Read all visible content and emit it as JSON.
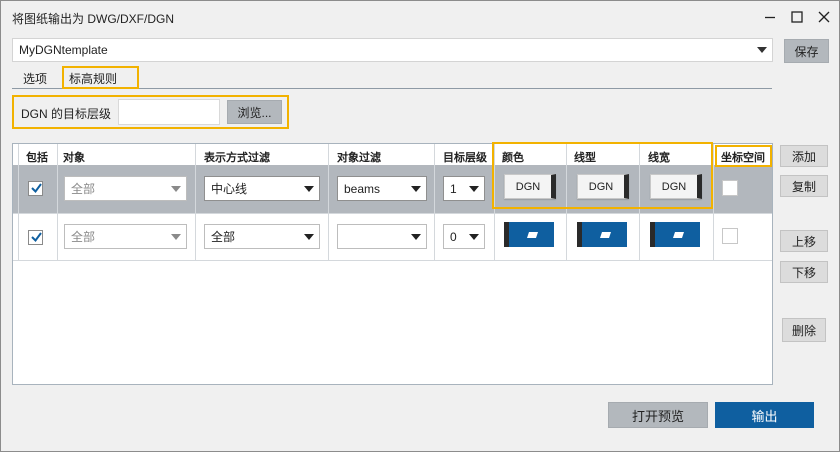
{
  "window": {
    "title": "将图纸输出为 DWG/DXF/DGN"
  },
  "template": {
    "value": "MyDGNtemplate",
    "save_label": "保存"
  },
  "tabs": [
    {
      "label": "选项"
    },
    {
      "label": "标高规则"
    }
  ],
  "layer": {
    "label": "DGN 的目标层级",
    "value": "",
    "browse_label": "浏览..."
  },
  "grid": {
    "headers": {
      "include": "包括",
      "object": "对象",
      "repr_filter": "表示方式过滤",
      "object_filter": "对象过滤",
      "target_level": "目标层级",
      "color": "颜色",
      "linetype": "线型",
      "linewidth": "线宽",
      "coord_space": "坐标空间"
    },
    "rows": [
      {
        "include": true,
        "object": "全部",
        "repr_filter": "中心线",
        "object_filter": "beams",
        "target_level": "1",
        "color": "DGN",
        "linetype": "DGN",
        "linewidth": "DGN",
        "coord_space": false,
        "selected": true
      },
      {
        "include": true,
        "object": "全部",
        "repr_filter": "全部",
        "object_filter": "",
        "target_level": "0",
        "color": "",
        "linetype": "",
        "linewidth": "",
        "coord_space": false,
        "selected": false
      }
    ]
  },
  "side_buttons": {
    "add": "添加",
    "copy": "复制",
    "up": "上移",
    "down": "下移",
    "delete": "删除"
  },
  "footer": {
    "preview": "打开预览",
    "export": "输出"
  },
  "colors": {
    "accent": "#0f5fa0",
    "highlight": "#f2b200",
    "selected_row": "#b2b7bd"
  }
}
